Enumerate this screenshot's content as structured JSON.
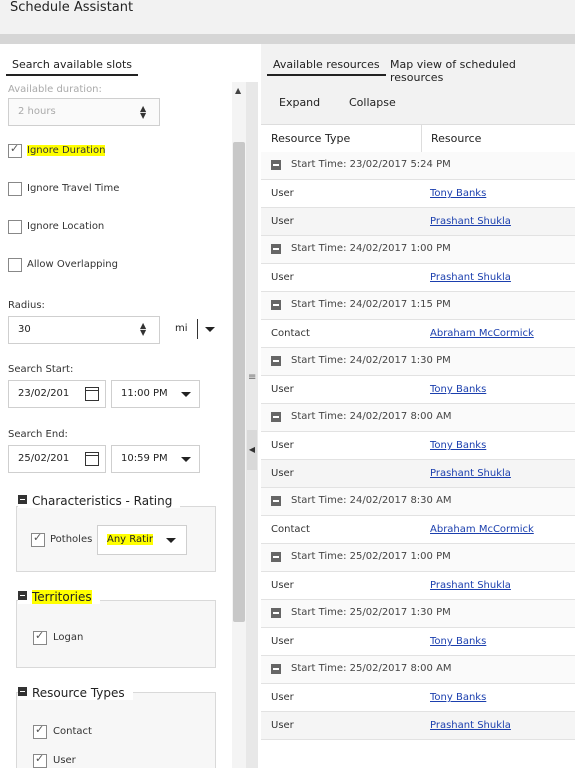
{
  "app": {
    "title": "Schedule Assistant"
  },
  "left": {
    "tab": "Search available slots",
    "available_duration": {
      "label": "Available duration:",
      "value": "2 hours"
    },
    "options": [
      {
        "label": "Ignore Duration",
        "checked": true,
        "highlight": true
      },
      {
        "label": "Ignore Travel Time",
        "checked": false
      },
      {
        "label": "Ignore Location",
        "checked": false
      },
      {
        "label": "Allow Overlapping",
        "checked": false
      }
    ],
    "radius": {
      "label": "Radius:",
      "value": "30",
      "unit": "mi"
    },
    "search_start": {
      "label": "Search Start:",
      "date": "23/02/201",
      "time": "11:00 PM"
    },
    "search_end": {
      "label": "Search End:",
      "date": "25/02/201",
      "time": "10:59 PM"
    },
    "characteristics": {
      "title": "Characteristics - Rating",
      "item": {
        "label": "Potholes",
        "checked": true
      },
      "rating": "Any Ratir"
    },
    "territories": {
      "title": "Territories",
      "items": [
        {
          "label": "Logan",
          "checked": true
        }
      ]
    },
    "resource_types": {
      "title": "Resource Types",
      "items": [
        {
          "label": "Contact",
          "checked": true
        },
        {
          "label": "User",
          "checked": true
        }
      ]
    }
  },
  "right": {
    "tabs": [
      "Available resources",
      "Map view of scheduled resources"
    ],
    "toolbar": {
      "expand": "Expand",
      "collapse": "Collapse"
    },
    "columns": [
      "Resource Type",
      "Resource"
    ],
    "groups": [
      {
        "start": "Start Time: 23/02/2017 5:24 PM",
        "rows": [
          [
            "User",
            "Tony Banks"
          ],
          [
            "User",
            "Prashant Shukla"
          ]
        ]
      },
      {
        "start": "Start Time: 24/02/2017 1:00 PM",
        "rows": [
          [
            "User",
            "Prashant Shukla"
          ]
        ]
      },
      {
        "start": "Start Time: 24/02/2017 1:15 PM",
        "rows": [
          [
            "Contact",
            "Abraham McCormick"
          ]
        ]
      },
      {
        "start": "Start Time: 24/02/2017 1:30 PM",
        "rows": [
          [
            "User",
            "Tony Banks"
          ]
        ]
      },
      {
        "start": "Start Time: 24/02/2017 8:00 AM",
        "rows": [
          [
            "User",
            "Tony Banks"
          ],
          [
            "User",
            "Prashant Shukla"
          ]
        ]
      },
      {
        "start": "Start Time: 24/02/2017 8:30 AM",
        "rows": [
          [
            "Contact",
            "Abraham McCormick"
          ]
        ]
      },
      {
        "start": "Start Time: 25/02/2017 1:00 PM",
        "rows": [
          [
            "User",
            "Prashant Shukla"
          ]
        ]
      },
      {
        "start": "Start Time: 25/02/2017 1:30 PM",
        "rows": [
          [
            "User",
            "Tony Banks"
          ]
        ]
      },
      {
        "start": "Start Time: 25/02/2017 8:00 AM",
        "rows": [
          [
            "User",
            "Tony Banks"
          ],
          [
            "User",
            "Prashant Shukla"
          ]
        ]
      }
    ]
  }
}
